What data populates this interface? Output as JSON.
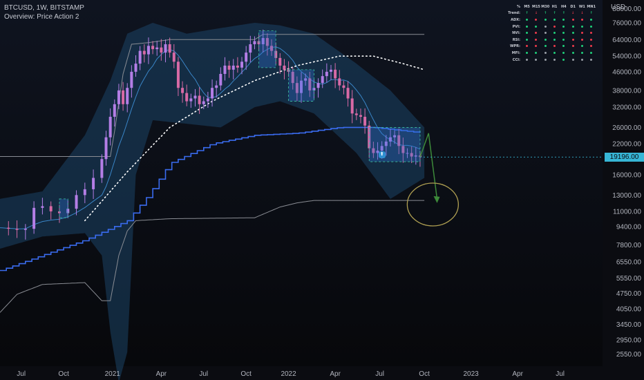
{
  "header": {
    "symbol_line": "BTCUSD, 1W, BITSTAMP",
    "overview_line": "Overview: Price Action 2"
  },
  "currency": "USD",
  "current_price": "19196.00",
  "colors": {
    "background": "#0b0c11",
    "up_candle": "#b47ee6",
    "down_candle": "#d86aa6",
    "channel_fill": "#1b4466",
    "inner_band": "#3a86c8",
    "stair_line": "#3a6cf0",
    "envelope_line": "#8a8d94",
    "dotted_curve": "#ffffff",
    "projection_arrow": "#3d8a3a",
    "target_circle": "#b0a052",
    "price_tag": "#37b6d6",
    "signal_up": "#1fd07b",
    "signal_down": "#ef3b4c",
    "signal_neutral": "#9aa0a8"
  },
  "indicator_table": {
    "timeframes": [
      "M5",
      "M15",
      "M30",
      "H1",
      "H4",
      "D1",
      "W1",
      "MN1"
    ],
    "trend_row": {
      "label": "Trend:",
      "symbols": [
        "↑",
        "↓",
        "↑",
        "↑",
        "↑",
        "↓",
        "↓",
        "↑"
      ]
    },
    "rows": [
      {
        "label": "ADX:",
        "signals": [
          "up",
          "down",
          "up",
          "up",
          "up",
          "down",
          "down",
          "up"
        ]
      },
      {
        "label": "PVI:",
        "signals": [
          "up",
          "up",
          "neutral",
          "down",
          "up",
          "up",
          "up",
          "up"
        ]
      },
      {
        "label": "NVI:",
        "signals": [
          "up",
          "down",
          "neutral",
          "up",
          "up",
          "up",
          "down",
          "down"
        ]
      },
      {
        "label": "RSI:",
        "signals": [
          "up",
          "down",
          "up",
          "up",
          "up",
          "down",
          "down",
          "down"
        ]
      },
      {
        "label": "WPR:",
        "signals": [
          "down",
          "down",
          "up",
          "down",
          "up",
          "down",
          "up",
          "down"
        ]
      },
      {
        "label": "MFI:",
        "signals": [
          "up",
          "up",
          "neutral",
          "up",
          "up",
          "up",
          "up",
          "up"
        ]
      },
      {
        "label": "CCI:",
        "signals": [
          "neutral",
          "neutral",
          "neutral",
          "neutral",
          "up",
          "neutral",
          "neutral",
          "neutral"
        ]
      }
    ]
  },
  "chart_data": {
    "type": "candlestick",
    "title": "BTCUSD, 1W, BITSTAMP",
    "y_axis_label": "USD",
    "y_scale": "log",
    "ylim": [
      2250,
      96000
    ],
    "y_ticks": [
      88000,
      76000,
      64000,
      54000,
      46000,
      38000,
      32000,
      26000,
      22000,
      19196,
      16000,
      13000,
      11000,
      9400,
      7800,
      6550,
      5550,
      4750,
      4050,
      3450,
      2950,
      2550
    ],
    "y_tick_labels": [
      "88000.00",
      "76000.00",
      "64000.00",
      "54000.00",
      "46000.00",
      "38000.00",
      "32000.00",
      "26000.00",
      "22000.00",
      "19196.00",
      "16000.00",
      "13000.00",
      "11000.00",
      "9400.00",
      "7800.00",
      "6550.00",
      "5550.00",
      "4750.00",
      "4050.00",
      "3450.00",
      "2950.00",
      "2550.00"
    ],
    "x_range_weeks": [
      0,
      142
    ],
    "x_ticks": [
      {
        "week": 5,
        "label": "Jul"
      },
      {
        "week": 15,
        "label": "Oct"
      },
      {
        "week": 26.5,
        "label": "2021"
      },
      {
        "week": 38,
        "label": "Apr"
      },
      {
        "week": 48,
        "label": "Jul"
      },
      {
        "week": 58,
        "label": "Oct"
      },
      {
        "week": 68,
        "label": "2022"
      },
      {
        "week": 79,
        "label": "Apr"
      },
      {
        "week": 89.5,
        "label": "Jul"
      },
      {
        "week": 100,
        "label": "Oct"
      },
      {
        "week": 111,
        "label": "2023"
      },
      {
        "week": 122,
        "label": "Apr"
      },
      {
        "week": 132,
        "label": "Jul"
      }
    ],
    "close_path": [
      [
        0,
        9300
      ],
      [
        2,
        9200
      ],
      [
        4,
        9100
      ],
      [
        6,
        9200
      ],
      [
        8,
        11400
      ],
      [
        10,
        11600
      ],
      [
        12,
        11000
      ],
      [
        14,
        10800
      ],
      [
        16,
        11300
      ],
      [
        18,
        13000
      ],
      [
        20,
        13800
      ],
      [
        22,
        15500
      ],
      [
        24,
        18800
      ],
      [
        25,
        23500
      ],
      [
        26,
        29000
      ],
      [
        27,
        33000
      ],
      [
        28,
        38000
      ],
      [
        29,
        33000
      ],
      [
        30,
        39000
      ],
      [
        31,
        46000
      ],
      [
        32,
        50000
      ],
      [
        33,
        57000
      ],
      [
        34,
        55000
      ],
      [
        35,
        60000
      ],
      [
        36,
        58000
      ],
      [
        37,
        59000
      ],
      [
        38,
        56000
      ],
      [
        39,
        61000
      ],
      [
        40,
        56000
      ],
      [
        41,
        51000
      ],
      [
        42,
        39000
      ],
      [
        43,
        37000
      ],
      [
        44,
        34000
      ],
      [
        45,
        35000
      ],
      [
        46,
        36000
      ],
      [
        47,
        33000
      ],
      [
        48,
        34000
      ],
      [
        49,
        35000
      ],
      [
        50,
        39000
      ],
      [
        51,
        40000
      ],
      [
        52,
        45000
      ],
      [
        53,
        49000
      ],
      [
        54,
        47000
      ],
      [
        55,
        49000
      ],
      [
        56,
        48000
      ],
      [
        57,
        51000
      ],
      [
        58,
        56000
      ],
      [
        59,
        61000
      ],
      [
        60,
        63000
      ],
      [
        61,
        61000
      ],
      [
        62,
        65000
      ],
      [
        63,
        60000
      ],
      [
        64,
        57000
      ],
      [
        65,
        53000
      ],
      [
        66,
        49000
      ],
      [
        67,
        47000
      ],
      [
        68,
        46000
      ],
      [
        69,
        41000
      ],
      [
        70,
        37000
      ],
      [
        71,
        42000
      ],
      [
        72,
        43000
      ],
      [
        73,
        38000
      ],
      [
        74,
        39000
      ],
      [
        75,
        41000
      ],
      [
        76,
        44000
      ],
      [
        77,
        46000
      ],
      [
        78,
        47000
      ],
      [
        79,
        43000
      ],
      [
        80,
        40000
      ],
      [
        81,
        39000
      ],
      [
        82,
        35000
      ],
      [
        83,
        30000
      ],
      [
        84,
        29500
      ],
      [
        85,
        29000
      ],
      [
        86,
        26500
      ],
      [
        87,
        21000
      ],
      [
        88,
        20000
      ],
      [
        89,
        20500
      ],
      [
        90,
        21500
      ],
      [
        91,
        22500
      ],
      [
        92,
        23500
      ],
      [
        93,
        24000
      ],
      [
        94,
        21500
      ],
      [
        95,
        20000
      ],
      [
        96,
        20000
      ],
      [
        97,
        19300
      ],
      [
        98,
        19500
      ],
      [
        99,
        19196
      ]
    ],
    "series": [
      {
        "name": "channel_upper",
        "values": [
          [
            0,
            12500
          ],
          [
            10,
            13500
          ],
          [
            20,
            24000
          ],
          [
            26,
            42000
          ],
          [
            30,
            68000
          ],
          [
            36,
            76000
          ],
          [
            44,
            68000
          ],
          [
            52,
            72000
          ],
          [
            60,
            76000
          ],
          [
            66,
            74000
          ],
          [
            74,
            68000
          ],
          [
            84,
            50000
          ],
          [
            92,
            38000
          ],
          [
            100,
            26000
          ]
        ]
      },
      {
        "name": "channel_lower",
        "values": [
          [
            0,
            7500
          ],
          [
            10,
            8500
          ],
          [
            20,
            8800
          ],
          [
            24,
            7000
          ],
          [
            26,
            3200
          ],
          [
            28,
            1900
          ],
          [
            30,
            2600
          ],
          [
            32,
            16000
          ],
          [
            36,
            28000
          ],
          [
            44,
            27000
          ],
          [
            52,
            26000
          ],
          [
            60,
            32000
          ],
          [
            66,
            34000
          ],
          [
            74,
            30000
          ],
          [
            84,
            20000
          ],
          [
            92,
            12500
          ],
          [
            100,
            15500
          ]
        ]
      },
      {
        "name": "stair_line",
        "values": [
          [
            0,
            6000
          ],
          [
            20,
            8200
          ],
          [
            30,
            10000
          ],
          [
            35,
            13000
          ],
          [
            40,
            18000
          ],
          [
            50,
            22000
          ],
          [
            60,
            24000
          ],
          [
            70,
            24500
          ],
          [
            80,
            26000
          ],
          [
            88,
            26000
          ],
          [
            100,
            24500
          ]
        ]
      },
      {
        "name": "envelope_upper",
        "values": [
          [
            0,
            19300
          ],
          [
            26,
            19300
          ],
          [
            27,
            25000
          ],
          [
            29,
            45000
          ],
          [
            31,
            61000
          ],
          [
            35,
            62000
          ],
          [
            40,
            64000
          ],
          [
            60,
            64000
          ],
          [
            62,
            67500
          ],
          [
            100,
            67500
          ]
        ]
      },
      {
        "name": "envelope_lower",
        "values": [
          [
            0,
            3900
          ],
          [
            4,
            4700
          ],
          [
            10,
            5200
          ],
          [
            20,
            5300
          ],
          [
            24,
            4400
          ],
          [
            26,
            4400
          ],
          [
            28,
            7000
          ],
          [
            30,
            9000
          ],
          [
            32,
            10000
          ],
          [
            40,
            10200
          ],
          [
            60,
            10300
          ],
          [
            66,
            11500
          ],
          [
            70,
            12000
          ],
          [
            74,
            12300
          ],
          [
            100,
            12300
          ]
        ]
      },
      {
        "name": "dotted_curve",
        "values": [
          [
            20,
            10000
          ],
          [
            30,
            16500
          ],
          [
            40,
            26000
          ],
          [
            50,
            34000
          ],
          [
            60,
            42000
          ],
          [
            70,
            49000
          ],
          [
            80,
            54000
          ],
          [
            88,
            54000
          ],
          [
            95,
            50000
          ],
          [
            100,
            47000
          ]
        ]
      }
    ],
    "range_boxes": [
      {
        "x": [
          61,
          65
        ],
        "y": [
          48000,
          70000
        ]
      },
      {
        "x": [
          68,
          74
        ],
        "y": [
          34000,
          47000
        ]
      },
      {
        "x": [
          87,
          99
        ],
        "y": [
          18300,
          26000
        ]
      },
      {
        "x": [
          14,
          16
        ],
        "y": [
          10300,
          12500
        ]
      }
    ],
    "projection": {
      "from": [
        99,
        19196
      ],
      "peak": [
        101,
        24500
      ],
      "to": [
        103,
        12500
      ]
    },
    "target_zone": {
      "center": [
        102,
        11800
      ],
      "note": "ellipse around projected target"
    }
  }
}
